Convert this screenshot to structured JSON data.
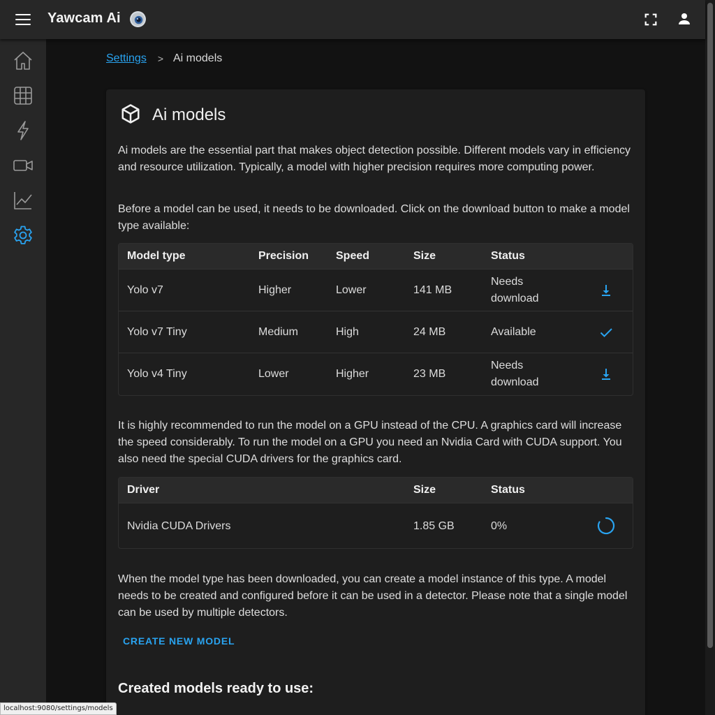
{
  "app": {
    "title": "Yawcam Ai",
    "menu_icon": "hamburger-menu-icon",
    "logo_icon": "webcam-logo-icon",
    "fullscreen_icon": "fullscreen-icon",
    "account_icon": "account-icon"
  },
  "sidebar": {
    "items": [
      {
        "name": "home",
        "icon": "home-icon",
        "active": false
      },
      {
        "name": "grid",
        "icon": "grid-icon",
        "active": false
      },
      {
        "name": "events",
        "icon": "lightning-icon",
        "active": false
      },
      {
        "name": "cameras",
        "icon": "video-camera-icon",
        "active": false
      },
      {
        "name": "statistics",
        "icon": "chart-icon",
        "active": false
      },
      {
        "name": "settings",
        "icon": "gear-icon",
        "active": true
      }
    ]
  },
  "breadcrumb": {
    "parent": "Settings",
    "separator": ">",
    "current": "Ai models"
  },
  "card": {
    "title": "Ai models",
    "icon": "cube-icon",
    "intro": "Ai models are the essential part that makes object detection possible. Different models vary in efficiency and resource utilization. Typically, a model with higher precision requires more computing power.",
    "download_hint": "Before a model can be used, it needs to be downloaded. Click on the download button to make a model type available:",
    "gpu_note": "It is highly recommended to run the model on a GPU instead of the CPU. A graphics card will increase the speed considerably. To run the model on a GPU you need an Nvidia Card with CUDA support. You also need the special CUDA drivers for the graphics card.",
    "instance_note": "When the model type has been downloaded, you can create a model instance of this type. A model needs to be created and configured before it can be used in a detector. Please note that a single model can be used by multiple detectors.",
    "create_button": "CREATE NEW MODEL",
    "created_heading": "Created models ready to use:"
  },
  "models_table": {
    "headers": [
      "Model type",
      "Precision",
      "Speed",
      "Size",
      "Status"
    ],
    "rows": [
      {
        "type": "Yolo v7",
        "precision": "Higher",
        "speed": "Lower",
        "size": "141 MB",
        "status": "Needs download",
        "action_icon": "download-icon"
      },
      {
        "type": "Yolo v7 Tiny",
        "precision": "Medium",
        "speed": "High",
        "size": "24 MB",
        "status": "Available",
        "action_icon": "check-icon"
      },
      {
        "type": "Yolo v4 Tiny",
        "precision": "Lower",
        "speed": "Higher",
        "size": "23 MB",
        "status": "Needs download",
        "action_icon": "download-icon"
      }
    ]
  },
  "drivers_table": {
    "headers": [
      "Driver",
      "Size",
      "Status"
    ],
    "rows": [
      {
        "driver": "Nvidia CUDA Drivers",
        "size": "1.85 GB",
        "status": "0%",
        "action_icon": "loading-spinner-icon"
      }
    ]
  },
  "statusbar": {
    "url": "localhost:9080/settings/models"
  },
  "colors": {
    "accent": "#29a3f0",
    "appbar": "#272727",
    "background": "#121212",
    "card": "#1e1e1e"
  }
}
